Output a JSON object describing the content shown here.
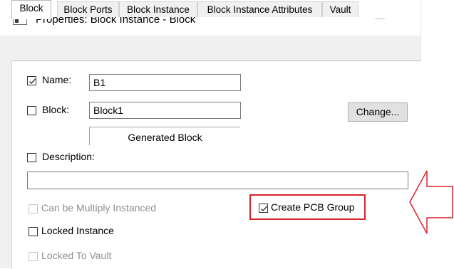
{
  "window": {
    "title": "Properties: Block Instance - Block"
  },
  "tabs": [
    {
      "label": "Block",
      "active": true
    },
    {
      "label": "Block Ports",
      "active": false
    },
    {
      "label": "Block Instance",
      "active": false
    },
    {
      "label": "Block Instance Attributes",
      "active": false
    },
    {
      "label": "Vault",
      "active": false
    }
  ],
  "form": {
    "name": {
      "label": "Name:",
      "checked": true,
      "value": "B1"
    },
    "block": {
      "label": "Block:",
      "checked": false,
      "value": "Block1",
      "change_button": "Change...",
      "generated_caption": "Generated Block"
    },
    "description": {
      "label": "Description:",
      "checked": false,
      "value": ""
    },
    "multiply_instanced": {
      "label": "Can be Multiply Instanced",
      "checked": false,
      "enabled": false
    },
    "create_pcb_group": {
      "label": "Create PCB Group",
      "checked": true,
      "enabled": true
    },
    "locked_instance": {
      "label": "Locked Instance",
      "checked": false,
      "enabled": true
    },
    "locked_to_vault": {
      "label": "Locked To Vault",
      "checked": false,
      "enabled": false
    }
  },
  "annotation": {
    "color": "#d9232a",
    "arrow_direction": "left"
  },
  "icons": {
    "app": "dialog-window-icon",
    "minimize": "minimize-icon",
    "check": "checkmark-icon"
  }
}
